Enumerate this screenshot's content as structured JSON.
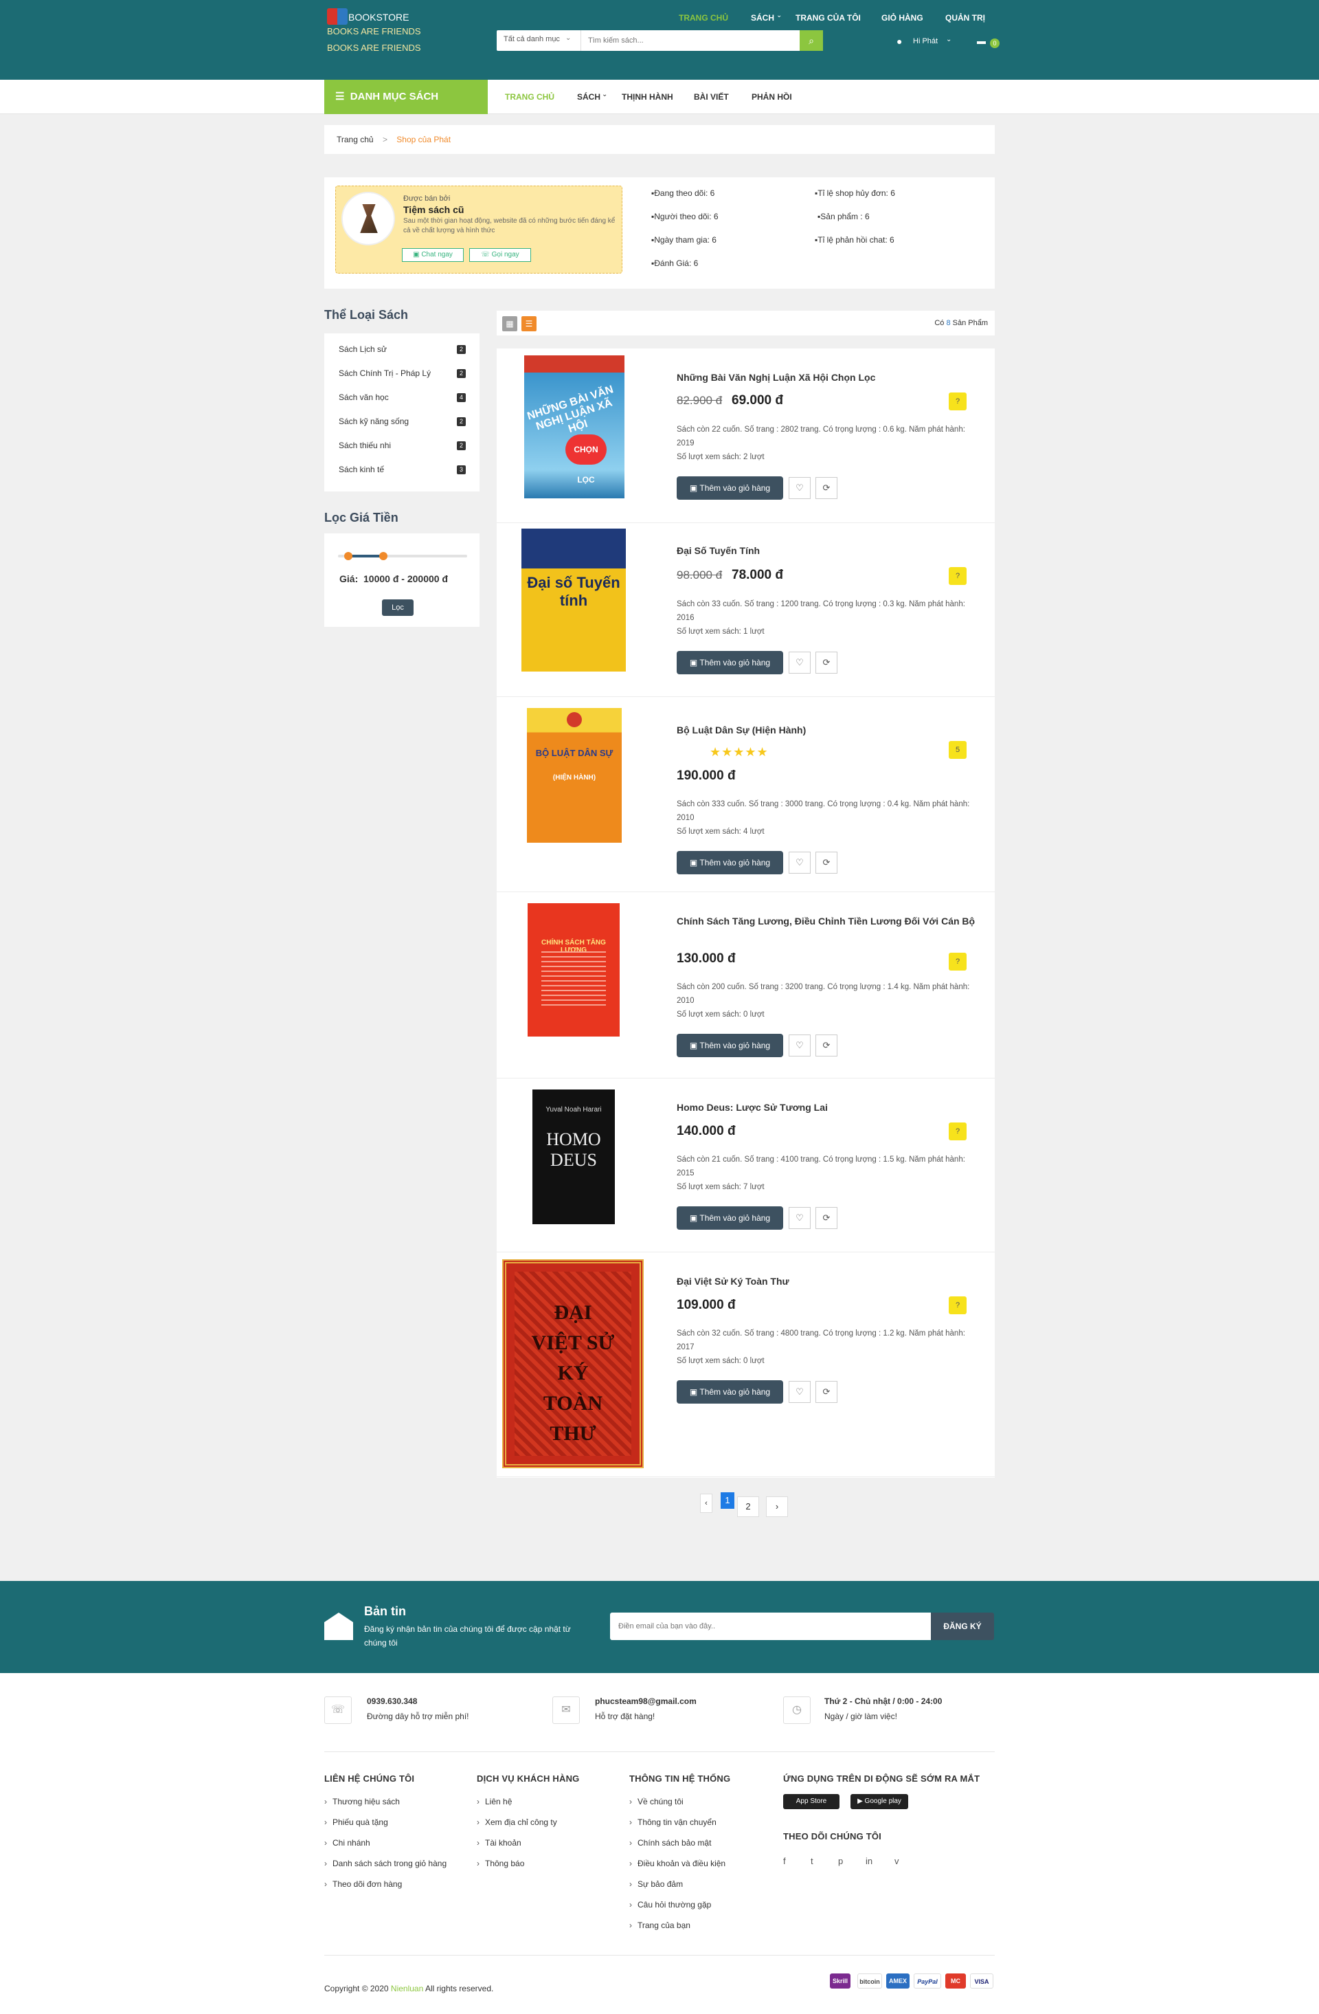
{
  "header": {
    "logo": {
      "line1": "BOOKSTORE",
      "line2": "BOOKS ARE FRIENDS",
      "line3": "BOOKS ARE FRIENDS"
    },
    "nav": [
      "TRANG CHỦ",
      "SÁCH",
      "TRANG CỦA TÔI",
      "GIỎ HÀNG",
      "QUẢN TRỊ"
    ],
    "search": {
      "category": "Tất cả danh mục",
      "placeholder": "Tìm kiếm sách..."
    },
    "user": "Hi Phát",
    "cart_count": "0"
  },
  "subnav": {
    "category_button": "DANH MỤC SÁCH",
    "items": [
      "TRANG CHỦ",
      "SÁCH",
      "THỊNH HÀNH",
      "BÀI VIẾT",
      "PHẢN HỒI"
    ]
  },
  "breadcrumb": {
    "home": "Trang chủ",
    "sep": ">",
    "current": "Shop của Phát"
  },
  "shop": {
    "sold_by": "Được bán bởi",
    "name": "Tiệm sách cũ",
    "desc": "Sau một thời gian hoạt động, website đã có những bước tiến đáng kể cả về chất lượng và hình thức",
    "chat_btn": "Chat ngay",
    "call_btn": "Gọi ngay",
    "stats": [
      "Đang theo dõi: 6",
      "Tỉ lệ shop hủy đơn: 6",
      "Người theo dõi: 6",
      "Sản phẩm : 6",
      "Ngày tham gia: 6",
      "Tỉ lệ phản hồi chat: 6",
      "Đánh Giá: 6"
    ]
  },
  "sidebar": {
    "categories_title": "Thể Loại Sách",
    "categories": [
      {
        "name": "Sách Lịch sử",
        "count": "2"
      },
      {
        "name": "Sách Chính Trị - Pháp Lý",
        "count": "2"
      },
      {
        "name": "Sách văn học",
        "count": "4"
      },
      {
        "name": "Sách kỹ năng sống",
        "count": "2"
      },
      {
        "name": "Sách thiếu nhi",
        "count": "2"
      },
      {
        "name": "Sách kinh tế",
        "count": "3"
      }
    ],
    "price_title": "Lọc Giá Tiền",
    "price_label": "Giá:",
    "price_range": "10000 đ - 200000 đ",
    "filter_btn": "Lọc",
    "slider": {
      "min": 0.08,
      "max": 0.35
    }
  },
  "toolbar": {
    "count_pre": "Có",
    "count": "8",
    "count_post": "Sản Phẩm"
  },
  "products": [
    {
      "title": "Những Bài Văn Nghị Luận Xã Hội Chọn Lọc",
      "old_price": "82.900 đ",
      "price": "69.000 đ",
      "badge": "?",
      "stars": "",
      "info": "Sách còn 22 cuốn. Số trang : 2802 trang. Có trọng lượng : 0.6 kg. Năm phát hành: 2019",
      "views": "Số lượt xem sách: 2 lượt",
      "add": "Thêm vào giỏ hàng",
      "cover": {
        "bg": "#3a94cc",
        "fg": "#fff",
        "text": "NHỮNG BÀI VĂN NGHỊ LUẬN XÃ HỘI",
        "sub": "CHỌN LỌC"
      }
    },
    {
      "title": "Đại Số Tuyến Tính",
      "old_price": "98.000 đ",
      "price": "78.000 đ",
      "badge": "?",
      "stars": "",
      "info": "Sách còn 33 cuốn. Số trang : 1200 trang. Có trọng lượng : 0.3 kg. Năm phát hành: 2016",
      "views": "Số lượt xem sách: 1 lượt",
      "add": "Thêm vào giỏ hàng",
      "cover": {
        "bg": "#f2c21b",
        "fg": "#1a2a5a",
        "text": "Đại số Tuyến tính",
        "sub": ""
      }
    },
    {
      "title": "Bộ Luật Dân Sự (Hiện Hành)",
      "old_price": "",
      "price": "190.000 đ",
      "badge": "5",
      "stars": "★★★★★",
      "info": "Sách còn 333 cuốn. Số trang : 3000 trang. Có trọng lượng : 0.4 kg. Năm phát hành: 2010",
      "views": "Số lượt xem sách: 4 lượt",
      "add": "Thêm vào giỏ hàng",
      "cover": {
        "bg": "#ee8a1c",
        "fg": "#fff",
        "text": "BỘ LUẬT DÂN SỰ",
        "sub": "(HIỆN HÀNH)"
      }
    },
    {
      "title": "Chính Sách Tăng Lương, Điều Chỉnh Tiền Lương Đối Với Cán Bộ",
      "old_price": "",
      "price": "130.000 đ",
      "badge": "?",
      "stars": "",
      "info": "Sách còn 200 cuốn. Số trang : 3200 trang. Có trọng lượng : 1.4 kg. Năm phát hành: 2010",
      "views": "Số lượt xem sách: 0 lượt",
      "add": "Thêm vào giỏ hàng",
      "cover": {
        "bg": "#e8361f",
        "fg": "#ffe680",
        "text": "CHÍNH SÁCH TĂNG LƯƠNG",
        "sub": ""
      }
    },
    {
      "title": "Homo Deus: Lược Sử Tương Lai",
      "old_price": "",
      "price": "140.000 đ",
      "badge": "?",
      "stars": "",
      "info": "Sách còn 21 cuốn. Số trang : 4100 trang. Có trọng lượng : 1.5 kg. Năm phát hành: 2015",
      "views": "Số lượt xem sách: 7 lượt",
      "add": "Thêm vào giỏ hàng",
      "cover": {
        "bg": "#111",
        "fg": "#eee",
        "text": "HOMO DEUS",
        "sub": "Yuval Noah Harari"
      }
    },
    {
      "title": "Đại Việt Sử Ký Toàn Thư",
      "old_price": "",
      "price": "109.000 đ",
      "badge": "?",
      "stars": "",
      "info": "Sách còn 32 cuốn. Số trang : 4800 trang. Có trọng lượng : 1.2 kg. Năm phát hành: 2017",
      "views": "Số lượt xem sách: 0 lượt",
      "add": "Thêm vào giỏ hàng",
      "cover": {
        "bg": "#c52a1a",
        "fg": "#2a0a05",
        "text": "ĐẠI VIỆT SỬ KÝ TOÀN THƯ",
        "sub": ""
      }
    }
  ],
  "pagination": {
    "prev": "‹",
    "pages": [
      "1",
      "2"
    ],
    "next": "›",
    "active": "1"
  },
  "newsletter": {
    "title": "Bản tin",
    "desc": "Đăng ký nhận bản tin của chúng tôi để được cập nhật từ chúng tôi",
    "placeholder": "Điền email của bạn vào đây..",
    "button": "ĐĂNG KÝ"
  },
  "contacts": [
    {
      "line1": "0939.630.348",
      "line2": "Đường dây hỗ trợ miễn phí!",
      "icon": "phone-icon"
    },
    {
      "line1": "phucsteam98@gmail.com",
      "line2": "Hỗ trợ đặt hàng!",
      "icon": "mail-icon"
    },
    {
      "line1": "Thứ 2 - Chủ nhật / 0:00 - 24:00",
      "line2": "Ngày / giờ làm việc!",
      "icon": "clock-icon"
    }
  ],
  "footer": {
    "cols": [
      {
        "title": "LIÊN HỆ CHÚNG TÔI",
        "items": [
          "Thương hiệu sách",
          "Phiếu quà tặng",
          "Chi nhánh",
          "Danh sách sách trong giỏ hàng",
          "Theo dõi đơn hàng"
        ]
      },
      {
        "title": "DỊCH VỤ KHÁCH HÀNG",
        "items": [
          "Liên hệ",
          "Xem địa chỉ công ty",
          "Tài khoản",
          "Thông báo"
        ]
      },
      {
        "title": "THÔNG TIN HỆ THỐNG",
        "items": [
          "Về chúng tôi",
          "Thông tin vận chuyển",
          "Chính sách bảo mật",
          "Điều khoản và điều kiện",
          "Sự bảo đảm",
          "Câu hỏi thường gặp",
          "Trang của bạn"
        ]
      }
    ],
    "app_title": "ỨNG DỤNG TRÊN DI ĐỘNG SẼ SỚM RA MẮT",
    "app_store": "App Store",
    "google_play": "Google play",
    "follow_title": "THEO DÕI CHÚNG TÔI",
    "social": [
      "f",
      "t",
      "p",
      "in",
      "v"
    ],
    "copyright_pre": "Copyright © 2020",
    "copyright_brand": "Nienluan",
    "copyright_post": "All rights reserved.",
    "payments": [
      "Skrill",
      "bitcoin",
      "AMEX",
      "PayPal",
      "MC",
      "VISA"
    ]
  },
  "colors": {
    "teal": "#1c6b73",
    "green": "#8cc63f",
    "orange": "#f08a2a",
    "dark": "#3d5160",
    "yellow": "#f7e21c"
  }
}
